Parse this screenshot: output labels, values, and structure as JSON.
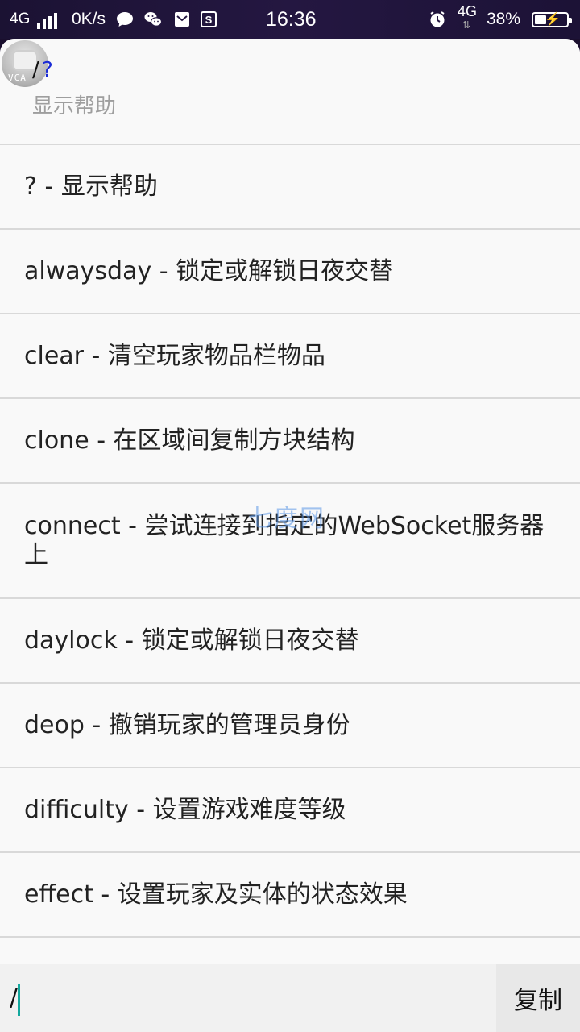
{
  "status_bar": {
    "network": "4G",
    "speed": "0K/s",
    "time": "16:36",
    "network2": "4G",
    "battery_percent": "38%",
    "battery_level": 0.38,
    "notification_icons": [
      "chat-bubble-icon",
      "wechat-icon",
      "mail-icon",
      "s-app-icon"
    ]
  },
  "header": {
    "command_slash": "/",
    "command_name": "?",
    "command_description": "显示帮助"
  },
  "commands": [
    {
      "text": "? - 显示帮助"
    },
    {
      "text": "alwaysday - 锁定或解锁日夜交替"
    },
    {
      "text": "clear - 清空玩家物品栏物品"
    },
    {
      "text": "clone - 在区域间复制方块结构"
    },
    {
      "text": "connect - 尝试连接到指定的WebSocket服务器上"
    },
    {
      "text": "daylock - 锁定或解锁日夜交替"
    },
    {
      "text": "deop - 撤销玩家的管理员身份"
    },
    {
      "text": "difficulty - 设置游戏难度等级"
    },
    {
      "text": "effect - 设置玩家及实体的状态效果"
    }
  ],
  "watermark": "七度网",
  "input": {
    "value": "/",
    "copy_label": "复制"
  },
  "colors": {
    "accent_caret": "#13a89e",
    "command_highlight": "#1a2bd6"
  }
}
